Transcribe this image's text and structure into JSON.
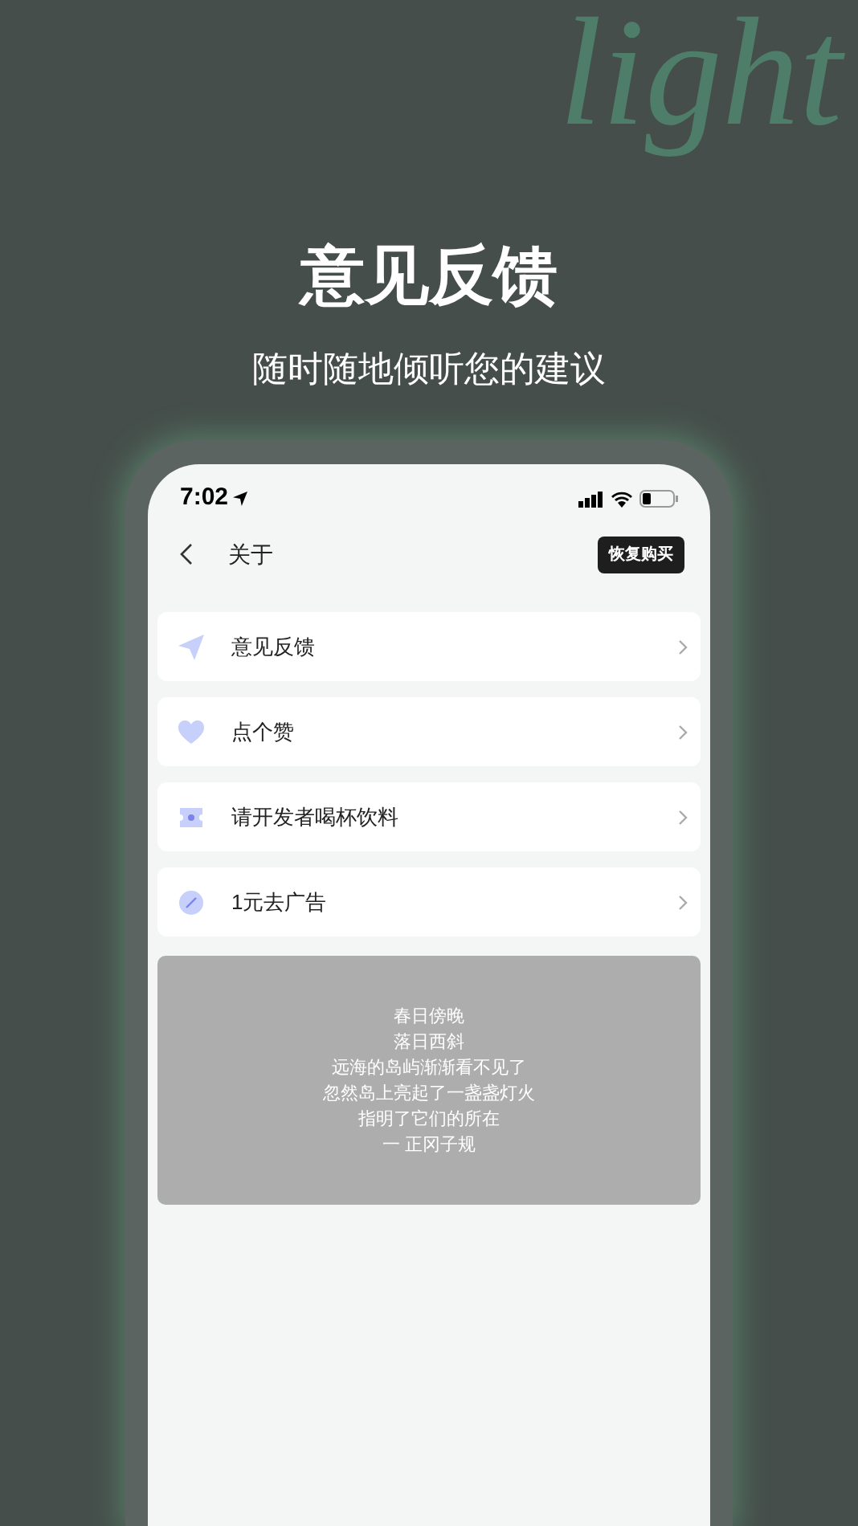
{
  "watermark_word": "light",
  "headline": "意见反馈",
  "subheadline": "随时随地倾听您的建议",
  "status_bar": {
    "time": "7:02"
  },
  "nav": {
    "title": "关于",
    "action": "恢复购买"
  },
  "menu": [
    {
      "kind": "send",
      "label": "意见反馈"
    },
    {
      "kind": "heart",
      "label": "点个赞"
    },
    {
      "kind": "ticket",
      "label": "请开发者喝杯饮料"
    },
    {
      "kind": "badge",
      "label": "1元去广告"
    }
  ],
  "poem": [
    "春日傍晚",
    "落日西斜",
    "远海的岛屿渐渐看不见了",
    "忽然岛上亮起了一盏盏灯火",
    "指明了它们的所在",
    "一 正冈子规"
  ]
}
